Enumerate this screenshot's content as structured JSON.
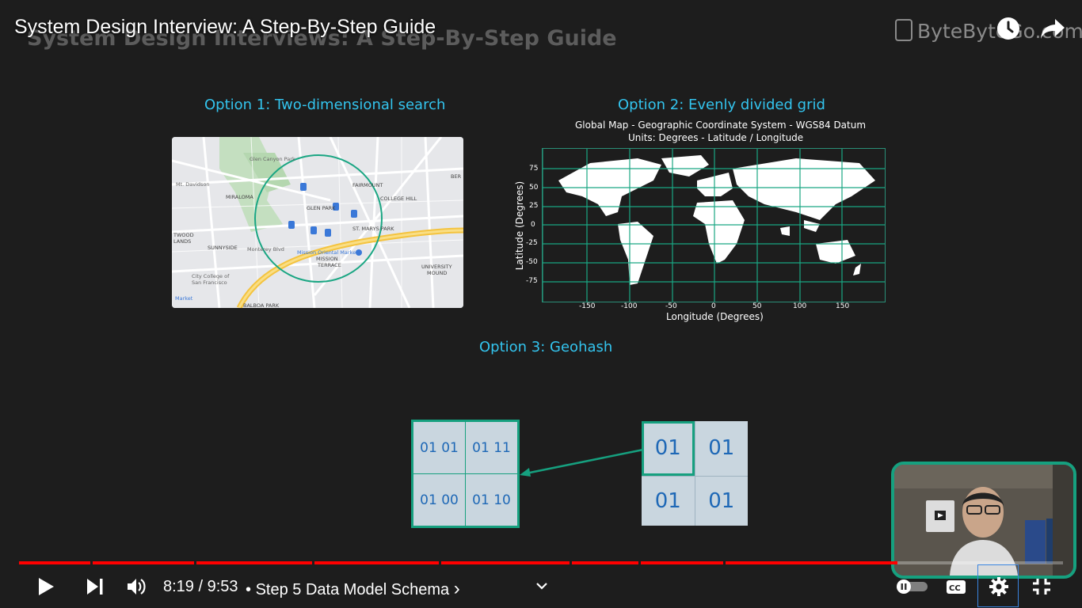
{
  "video": {
    "title": "System Design Interview: A Step-By-Step Guide",
    "slide_header": "System Design Interviews: A Step-By-Step Guide",
    "brand": "ByteByteGo.com"
  },
  "slide": {
    "option1": {
      "title": "Option 1: Two-dimensional search",
      "map_labels": [
        "Glen Canyon Park",
        "Mt. Davidson",
        "MIRALOMA",
        "GLEN PARK",
        "FAIRMOUNT",
        "COLLEGE HILL",
        "ST. MARYS PARK",
        "TWOOD LANDS",
        "SUNNYSIDE",
        "Monterey Blvd",
        "Mission Oriental Market",
        "MISSION TERRACE",
        "UNIVERSITY MOUND",
        "City College of San Francisco",
        "BALBOA PARK",
        "Market",
        "BER"
      ]
    },
    "option2": {
      "title": "Option 2: Evenly divided grid",
      "map_title": "Global Map - Geographic Coordinate System - WGS84 Datum",
      "units": "Units: Degrees - Latitude / Longitude",
      "y_axis_label": "Latitude (Degrees)",
      "x_axis_label": "Longitude (Degrees)",
      "y_ticks": [
        "75",
        "50",
        "25",
        "0",
        "-25",
        "-50",
        "-75"
      ],
      "x_ticks": [
        "-150",
        "-100",
        "-50",
        "0",
        "50",
        "100",
        "150"
      ]
    },
    "option3": {
      "title": "Option 3: Geohash",
      "left_grid": [
        [
          "01 01",
          "01 11"
        ],
        [
          "01 00",
          "01 10"
        ]
      ],
      "right_grid": [
        [
          "01",
          "01"
        ],
        [
          "01",
          "01"
        ]
      ]
    }
  },
  "player": {
    "time_current": "8:19",
    "time_total": "9:53",
    "separator": "/",
    "chapter_bullet": "•",
    "chapter": "Step 5 Data Model Schema",
    "chapter_chevron": "›",
    "progress_fraction": 0.8417,
    "chapter_fractions": [
      0.0683,
      0.1676,
      0.2811,
      0.4022,
      0.5273,
      0.593,
      0.6744
    ],
    "icons": {
      "play": "play-icon",
      "next": "next-icon",
      "volume": "volume-icon",
      "chapter_expand": "chevron-down-icon",
      "autoplay": "autoplay-toggle-icon",
      "captions": "captions-icon",
      "settings": "gear-icon",
      "exit_fullscreen": "exit-fullscreen-icon",
      "watch_later": "clock-icon",
      "share": "share-icon"
    },
    "accent": "#ff0000"
  },
  "colors": {
    "option_title": "#33c4ee",
    "teal": "#16a07f",
    "geohash_text": "#1e68b6"
  }
}
